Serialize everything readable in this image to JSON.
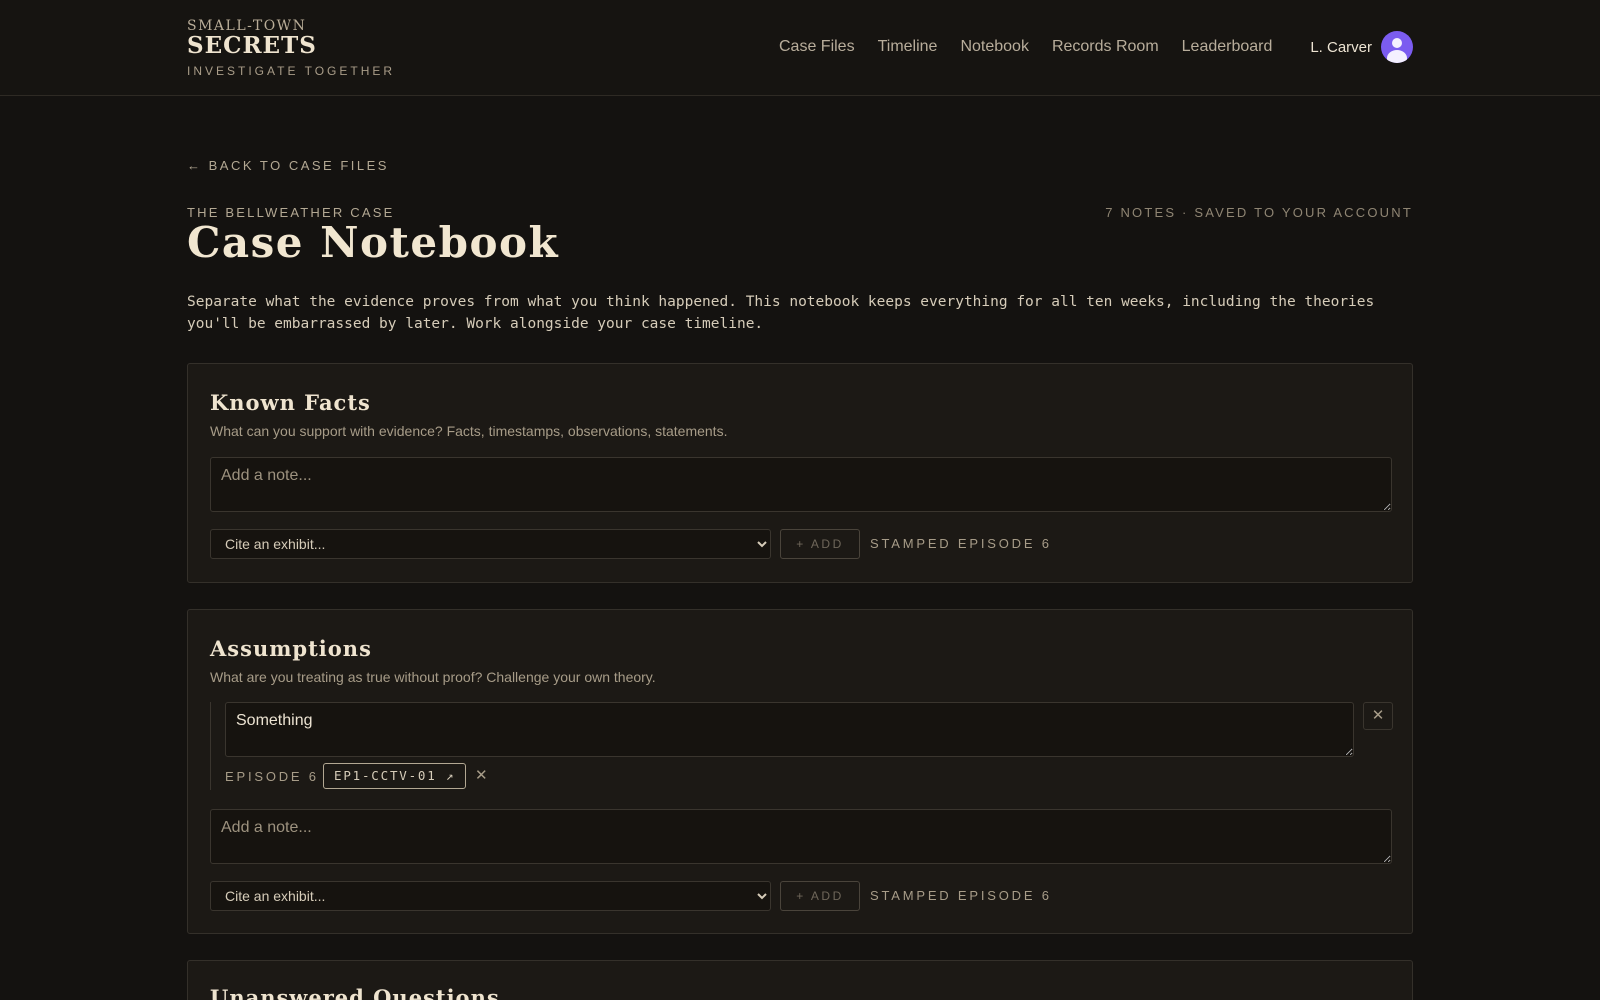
{
  "brand": {
    "small": "SMALL-TOWN",
    "big": "SECRETS",
    "tagline": "INVESTIGATE TOGETHER"
  },
  "nav": [
    "Case Files",
    "Timeline",
    "Notebook",
    "Records Room",
    "Leaderboard"
  ],
  "user": {
    "name": "L. Carver"
  },
  "back_link": "← BACK TO CASE FILES",
  "case_label": "THE BELLWEATHER CASE",
  "meta": "7 NOTES · SAVED TO YOUR ACCOUNT",
  "title": "Case Notebook",
  "intro": "Separate what the evidence proves from what you think happened. This notebook keeps everything for all ten weeks, including the theories you'll be embarrassed by later. Work alongside your case timeline.",
  "sections": [
    {
      "title": "Known Facts",
      "description": "What can you support with evidence? Facts, timestamps, observations, statements.",
      "new_note_placeholder": "Add a note...",
      "exhibit_select": "Cite an exhibit...",
      "add_label": "+ ADD",
      "stamp": "STAMPED EPISODE 6"
    },
    {
      "title": "Assumptions",
      "description": "What are you treating as true without proof? Challenge your own theory.",
      "notes": [
        {
          "text": "Something",
          "episode": "EPISODE 6",
          "exhibit": "EP1-CCTV-01 ↗"
        }
      ],
      "new_note_placeholder": "Add a note...",
      "exhibit_select": "Cite an exhibit...",
      "add_label": "+ ADD",
      "stamp": "STAMPED EPISODE 6"
    },
    {
      "title": "Unanswered Questions"
    }
  ],
  "icons": {
    "close": "close-icon",
    "remove": "remove-icon"
  }
}
